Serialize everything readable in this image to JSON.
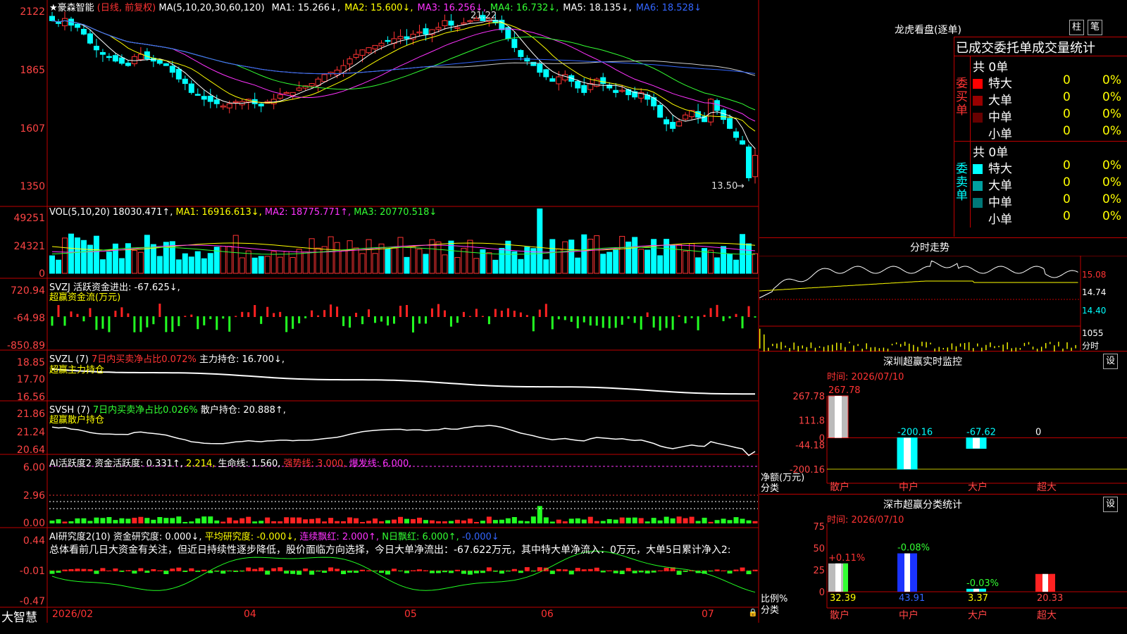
{
  "stock": {
    "name": "★豪森智能",
    "mode": "(日线, 前复权)",
    "ma_label": "MA(5,10,20,30,60,120)",
    "ma": [
      {
        "label": "MA1:",
        "value": "15.266↓,",
        "color": "#ffffff"
      },
      {
        "label": "MA2:",
        "value": "15.600↓,",
        "color": "#ffff00"
      },
      {
        "label": "MA3:",
        "value": "16.256↓,",
        "color": "#ff33ff"
      },
      {
        "label": "MA4:",
        "value": "16.732↓,",
        "color": "#33ff33"
      },
      {
        "label": "MA5:",
        "value": "18.135↓,",
        "color": "#ffffff"
      },
      {
        "label": "MA6:",
        "value": "18.528↓",
        "color": "#3366ff"
      }
    ],
    "high_mark": "21.22",
    "low_mark": "13.50",
    "price_axis": [
      "2122",
      "1865",
      "1607",
      "1350"
    ],
    "chart_data": {
      "type": "line",
      "ylim": [
        13.5,
        21.22
      ],
      "x_labels": [
        "2026/02",
        "04",
        "05",
        "06",
        "07"
      ],
      "close": [
        20.8,
        20.7,
        20.9,
        20.6,
        20.5,
        20.2,
        19.8,
        19.5,
        19.3,
        19.2,
        19.0,
        18.9,
        18.8,
        19.2,
        19.3,
        19.1,
        19.0,
        18.9,
        18.8,
        18.5,
        18.2,
        18.0,
        17.6,
        17.5,
        17.3,
        17.2,
        17.1,
        17.0,
        17.1,
        17.2,
        17.2,
        17.3,
        17.1,
        17.0,
        17.2,
        17.3,
        17.5,
        17.6,
        17.6,
        17.8,
        17.9,
        18.0,
        18.2,
        18.4,
        18.5,
        18.6,
        18.8,
        19.1,
        19.3,
        19.5,
        19.6,
        19.7,
        19.8,
        19.9,
        20.0,
        20.1,
        20.0,
        20.2,
        20.3,
        20.2,
        20.4,
        20.5,
        20.8,
        20.6,
        20.5,
        20.7,
        20.8,
        20.9,
        20.8,
        20.9,
        20.7,
        20.4,
        20.0,
        19.6,
        19.2,
        19.0,
        18.8,
        18.5,
        18.3,
        18.1,
        18.3,
        18.4,
        18.1,
        17.8,
        17.6,
        18.0,
        18.2,
        18.0,
        17.8,
        17.6,
        17.7,
        17.5,
        17.4,
        17.6,
        17.3,
        17.0,
        16.5,
        16.2,
        16.0,
        16.3,
        16.6,
        16.8,
        16.5,
        16.3,
        17.3,
        16.8,
        16.4,
        16.0,
        15.6,
        15.3,
        13.8,
        14.8
      ]
    }
  },
  "vol": {
    "label": "VOL(5,10,20)",
    "value": "18030.471↑,",
    "ma1": "MA1: 16916.613↓,",
    "ma2": "MA2: 18775.771↑,",
    "ma3": "MA3: 20770.518↓",
    "axis": [
      "49251",
      "24321",
      "0"
    ],
    "chart_data": {
      "type": "bar",
      "ylim": [
        0,
        49251
      ]
    }
  },
  "svzj": {
    "label": "SVZJ 活跃资金进出:",
    "value": "-67.625↓,",
    "sub": "超赢资金流(万元)",
    "axis": [
      "720.94",
      "-64.98",
      "-850.89"
    ]
  },
  "svzl": {
    "label": "SVZL (7)",
    "ratio": "7日内买卖净占比0.072%",
    "hold": "主力持仓: 16.700↓,",
    "sub": "超赢主力持仓",
    "axis": [
      "18.85",
      "17.70",
      "16.56"
    ]
  },
  "svsh": {
    "label": "SVSH (7)",
    "ratio": "7日内买卖净占比0.026%",
    "hold": "散户持仓: 20.888↑,",
    "sub": "超赢散户持仓",
    "axis": [
      "21.86",
      "21.24",
      "20.64"
    ]
  },
  "ai_active": {
    "label": "AI活跃度2 资金活跃度: 0.331↑,",
    "v2": "2.214,",
    "life": "生命线: 1.560,",
    "strong": "强势线: 3.000,",
    "burst": "爆发线: 6.000,",
    "axis": [
      "6.00",
      "2.96",
      "0.00"
    ]
  },
  "ai_research": {
    "label": "AI研究度2(10) 资金研究度: 0.000↓,",
    "avg": "平均研究度: -0.000↓,",
    "cont": "连续飘红: 2.000↑,",
    "nday": "N日飘红: 6.000↑,",
    "last": "-0.000↓",
    "summary": "总体看前几日大资金有关注，但近日持续性逐步降低，股价面临方向选择，今日大单净流出：-67.622万元，其中特大单净流入：0万元，大单5日累计净入2:",
    "axis": [
      "0.44",
      "-0.01",
      "-0.47"
    ]
  },
  "xaxis": {
    "brand": "大智慧",
    "labels": [
      "2026/02",
      "04",
      "05",
      "06",
      "07"
    ]
  },
  "dragon": {
    "title": "龙虎看盘(逐单)",
    "btn1": "柱",
    "btn2": "笔",
    "header": "已成交委托单成交量统计",
    "buy_side": "委买单",
    "sell_side": "委卖单",
    "buy_total": "共 0单",
    "sell_total": "共 0单",
    "buy_rows": [
      {
        "label": "特大",
        "count": "0",
        "pct": "0%",
        "color": "#ff0000"
      },
      {
        "label": "大单",
        "count": "0",
        "pct": "0%",
        "color": "#990000"
      },
      {
        "label": "中单",
        "count": "0",
        "pct": "0%",
        "color": "#660000"
      },
      {
        "label": "小单",
        "count": "0",
        "pct": "0%",
        "color": "#000000"
      }
    ],
    "sell_rows": [
      {
        "label": "特大",
        "count": "0",
        "pct": "0%",
        "color": "#00ffff"
      },
      {
        "label": "大单",
        "count": "0",
        "pct": "0%",
        "color": "#00a0a0"
      },
      {
        "label": "中单",
        "count": "0",
        "pct": "0%",
        "color": "#007777"
      },
      {
        "label": "小单",
        "count": "0",
        "pct": "0%",
        "color": "#000000"
      }
    ]
  },
  "intraday": {
    "title": "分时走势",
    "axis": [
      "15.08",
      "14.74",
      "14.40",
      "1055",
      "分时"
    ]
  },
  "monitor": {
    "title": "深圳超赢实时监控",
    "btn": "设",
    "time": "时间: 2026/07/10",
    "axis": [
      "267.78",
      "111.8",
      "0",
      "-44.18",
      "-200.16"
    ],
    "ylabel": "净额(万元)",
    "xlabel": "分类",
    "chart_data": {
      "type": "bar",
      "categories": [
        "散户",
        "中户",
        "大户",
        "超大"
      ],
      "values": [
        267.78,
        -200.16,
        -67.62,
        0
      ],
      "labels": [
        "267.78",
        "-200.16",
        "-67.62",
        "0"
      ],
      "ylim": [
        -200.16,
        267.78
      ]
    }
  },
  "classify": {
    "title": "深市超赢分类统计",
    "btn": "设",
    "time": "时间: 2026/07/10",
    "axis": [
      "75",
      "50",
      "25",
      "0"
    ],
    "ylabel": "比例%",
    "xlabel": "分类",
    "chart_data": {
      "type": "bar",
      "categories": [
        "散户",
        "中户",
        "大户",
        "超大"
      ],
      "values": [
        32.39,
        43.91,
        3.37,
        20.33
      ],
      "changes": [
        "+0.11%",
        "-0.08%",
        "-0.03%",
        ""
      ],
      "labels": [
        "32.39",
        "43.91",
        "3.37",
        "20.33"
      ],
      "ylim": [
        0,
        75
      ]
    }
  }
}
